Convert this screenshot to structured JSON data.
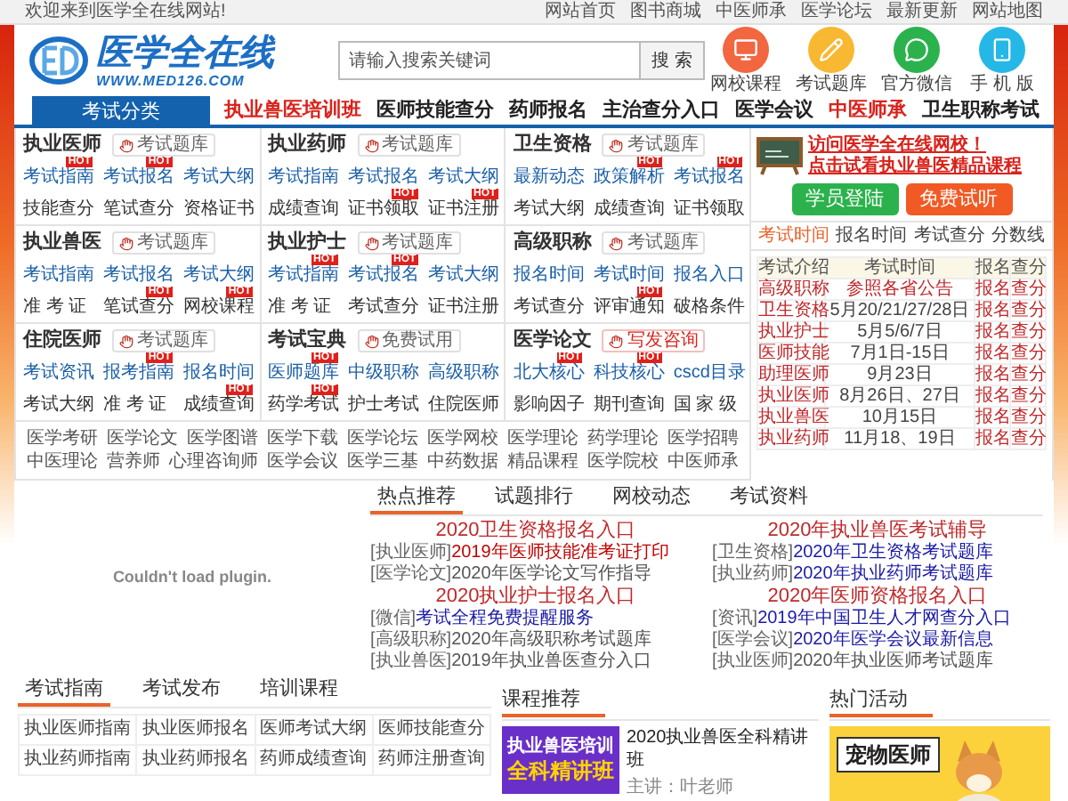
{
  "top_bar": {
    "welcome": "欢迎来到医学全在线网站!",
    "links": [
      "网站首页",
      "图书商城",
      "中医师承",
      "医学论坛",
      "最新更新",
      "网站地图"
    ]
  },
  "header": {
    "logo_text": "医学全在线",
    "logo_url": "WWW.MED126.COM",
    "search": {
      "placeholder": "请输入搜索关键词",
      "button": "搜 索"
    },
    "shortcuts": [
      {
        "label": "网校课程",
        "kind": "monitor",
        "color": "#f26640"
      },
      {
        "label": "考试题库",
        "kind": "pencil",
        "color": "#f8b832"
      },
      {
        "label": "官方微信",
        "kind": "chat",
        "color": "#2bb24c"
      },
      {
        "label": "手 机 版",
        "kind": "phone",
        "color": "#25b8e6"
      }
    ]
  },
  "nav": {
    "category": "考试分类",
    "items": [
      {
        "label": "执业兽医培训班",
        "highlight": true
      },
      {
        "label": "医师技能查分",
        "highlight": false
      },
      {
        "label": "药师报名",
        "highlight": false
      },
      {
        "label": "主治查分入口",
        "highlight": false
      },
      {
        "label": "医学会议",
        "highlight": false
      },
      {
        "label": "中医师承",
        "highlight": true
      },
      {
        "label": "卫生职称考试",
        "highlight": false
      }
    ]
  },
  "categories": [
    {
      "title": "执业医师",
      "button": {
        "label": "考试题库",
        "kind": "normal"
      },
      "rows": [
        {
          "kind": "primary",
          "links": [
            {
              "label": "考试指南",
              "badge": "HOT"
            },
            {
              "label": "考试报名",
              "badge": "HOT"
            },
            {
              "label": "考试大纲"
            }
          ]
        },
        {
          "kind": "secondary",
          "links": [
            {
              "label": "技能查分"
            },
            {
              "label": "笔试查分"
            },
            {
              "label": "资格证书"
            }
          ]
        }
      ]
    },
    {
      "title": "执业药师",
      "button": {
        "label": "考试题库",
        "kind": "normal"
      },
      "rows": [
        {
          "kind": "primary",
          "links": [
            {
              "label": "考试指南"
            },
            {
              "label": "考试报名"
            },
            {
              "label": "考试大纲"
            }
          ]
        },
        {
          "kind": "secondary",
          "links": [
            {
              "label": "成绩查询"
            },
            {
              "label": "证书领取",
              "badge": "HOT"
            },
            {
              "label": "证书注册",
              "badge": "HOT"
            }
          ]
        }
      ]
    },
    {
      "title": "卫生资格",
      "button": {
        "label": "考试题库",
        "kind": "normal"
      },
      "rows": [
        {
          "kind": "primary",
          "links": [
            {
              "label": "最新动态"
            },
            {
              "label": "政策解析",
              "badge": "HOT"
            },
            {
              "label": "考试报名",
              "badge": "HOT"
            }
          ]
        },
        {
          "kind": "secondary",
          "links": [
            {
              "label": "考试大纲"
            },
            {
              "label": "成绩查询"
            },
            {
              "label": "证书领取"
            }
          ]
        }
      ]
    },
    {
      "title": "执业兽医",
      "button": {
        "label": "考试题库",
        "kind": "normal"
      },
      "rows": [
        {
          "kind": "primary",
          "links": [
            {
              "label": "考试指南"
            },
            {
              "label": "考试报名"
            },
            {
              "label": "考试大纲"
            }
          ]
        },
        {
          "kind": "secondary",
          "links": [
            {
              "label": "准 考 证"
            },
            {
              "label": "笔试查分",
              "badge": "HOT"
            },
            {
              "label": "网校课程",
              "badge": "HOT"
            }
          ]
        }
      ]
    },
    {
      "title": "执业护士",
      "button": {
        "label": "考试题库",
        "kind": "normal"
      },
      "rows": [
        {
          "kind": "primary",
          "links": [
            {
              "label": "考试指南",
              "badge": "HOT"
            },
            {
              "label": "考试报名",
              "badge": "HOT"
            },
            {
              "label": "考试大纲"
            }
          ]
        },
        {
          "kind": "secondary",
          "links": [
            {
              "label": "准 考 证"
            },
            {
              "label": "考试查分"
            },
            {
              "label": "证书注册"
            }
          ]
        }
      ]
    },
    {
      "title": "高级职称",
      "button": {
        "label": "考试题库",
        "kind": "normal"
      },
      "rows": [
        {
          "kind": "primary",
          "links": [
            {
              "label": "报名时间"
            },
            {
              "label": "考试时间"
            },
            {
              "label": "报名入口"
            }
          ]
        },
        {
          "kind": "secondary",
          "links": [
            {
              "label": "考试查分"
            },
            {
              "label": "评审通知",
              "badge": "HOT"
            },
            {
              "label": "破格条件"
            }
          ]
        }
      ]
    },
    {
      "title": "住院医师",
      "button": {
        "label": "考试题库",
        "kind": "normal"
      },
      "rows": [
        {
          "kind": "primary",
          "links": [
            {
              "label": "考试资讯"
            },
            {
              "label": "报考指南",
              "badge": "HOT"
            },
            {
              "label": "报名时间"
            }
          ]
        },
        {
          "kind": "secondary",
          "links": [
            {
              "label": "考试大纲"
            },
            {
              "label": "准 考 证"
            },
            {
              "label": "成绩查询",
              "badge": "HOT"
            }
          ]
        }
      ]
    },
    {
      "title": "考试宝典",
      "button": {
        "label": "免费试用",
        "kind": "normal"
      },
      "rows": [
        {
          "kind": "primary",
          "links": [
            {
              "label": "医师题库",
              "badge": "HOT"
            },
            {
              "label": "中级职称"
            },
            {
              "label": "高级职称"
            }
          ]
        },
        {
          "kind": "secondary",
          "links": [
            {
              "label": "药学考试",
              "badge": "HOT"
            },
            {
              "label": "护士考试"
            },
            {
              "label": "住院医师"
            }
          ]
        }
      ]
    },
    {
      "title": "医学论文",
      "button": {
        "label": "写发咨询",
        "kind": "accent"
      },
      "rows": [
        {
          "kind": "primary",
          "links": [
            {
              "label": "北大核心",
              "badge": "HOT"
            },
            {
              "label": "科技核心",
              "badge": "HOT"
            },
            {
              "label": "cscd目录"
            }
          ]
        },
        {
          "kind": "secondary",
          "links": [
            {
              "label": "影响因子"
            },
            {
              "label": "期刊查询"
            },
            {
              "label": "国 家 级"
            }
          ]
        }
      ]
    }
  ],
  "quick_links": [
    [
      "医学考研",
      "医学论文",
      "医学图谱",
      "医学下载",
      "医学论坛",
      "医学网校",
      "医学理论",
      "药学理论",
      "医学招聘"
    ],
    [
      "中医理论",
      "营养师",
      "心理咨询师",
      "医学会议",
      "医学三基",
      "中药数据",
      "精品课程",
      "医学院校",
      "中医师承"
    ]
  ],
  "side_panel": {
    "promo_links": [
      "访问医学全在线网校！",
      "点击试看执业兽医精品课程"
    ],
    "buttons": [
      {
        "label": "学员登陆",
        "kind": "login"
      },
      {
        "label": "免费试听",
        "kind": "trial"
      }
    ],
    "tabs": [
      {
        "label": "考试时间",
        "selected": true
      },
      {
        "label": "报名时间",
        "selected": false
      },
      {
        "label": "考试查分",
        "selected": false
      },
      {
        "label": "分数线",
        "selected": false
      }
    ],
    "table": {
      "columns": [
        "考试介绍",
        "考试时间",
        "报名",
        "查分"
      ],
      "rows": [
        {
          "name": "高级职称",
          "time": "参照各省公告",
          "highlight": true,
          "signup": "报名",
          "score": "查分"
        },
        {
          "name": "卫生资格",
          "time": "5月20/21/27/28日",
          "highlight": false,
          "signup": "报名",
          "score": "查分"
        },
        {
          "name": "执业护士",
          "time": "5月5/6/7日",
          "highlight": false,
          "signup": "报名",
          "score": "查分"
        },
        {
          "name": "医师技能",
          "time": "7月1日-15日",
          "highlight": false,
          "signup": "报名",
          "score": "查分"
        },
        {
          "name": "助理医师",
          "time": "9月23日",
          "highlight": false,
          "signup": "报名",
          "score": "查分"
        },
        {
          "name": "执业医师",
          "time": "8月26日、27日",
          "highlight": false,
          "signup": "报名",
          "score": "查分"
        },
        {
          "name": "执业兽医",
          "time": "10月15日",
          "highlight": false,
          "signup": "报名",
          "score": "查分"
        },
        {
          "name": "执业药师",
          "time": "11月18、19日",
          "highlight": false,
          "signup": "报名",
          "score": "查分"
        }
      ]
    }
  },
  "plugin": {
    "message": "Couldn't load plugin."
  },
  "news": {
    "tabs": [
      {
        "label": "热点推荐",
        "selected": true
      },
      {
        "label": "试题排行",
        "selected": false
      },
      {
        "label": "网校动态",
        "selected": false
      },
      {
        "label": "考试资料",
        "selected": false
      }
    ],
    "columns": [
      [
        {
          "kind": "heading",
          "text": "2020卫生资格报名入口"
        },
        {
          "kind": "item",
          "tag": "[执业医师]",
          "text": "2019年医师技能准考证打印",
          "color": "#c00000"
        },
        {
          "kind": "item",
          "tag": "[医学论文]",
          "text": "2020年医学论文写作指导",
          "color": "#555555"
        },
        {
          "kind": "heading",
          "text": "2020执业护士报名入口"
        },
        {
          "kind": "item",
          "tag": "[微信]",
          "text": "考试全程免费提醒服务",
          "color": "#1a1aa6"
        },
        {
          "kind": "item",
          "tag": "[高级职称]",
          "text": "2020年高级职称考试题库",
          "color": "#555555"
        },
        {
          "kind": "item",
          "tag": "[执业兽医]",
          "text": "2019年执业兽医查分入口",
          "color": "#555555"
        }
      ],
      [
        {
          "kind": "heading",
          "text": "2020年执业兽医考试辅导"
        },
        {
          "kind": "item",
          "tag": "[卫生资格]",
          "text": "2020年卫生资格考试题库",
          "color": "#1a1aa6"
        },
        {
          "kind": "item",
          "tag": "[执业药师]",
          "text": "2020年执业药师考试题库",
          "color": "#1a1aa6"
        },
        {
          "kind": "heading",
          "text": "2020年医师资格报名入口"
        },
        {
          "kind": "item",
          "tag": "[资讯]",
          "text": "2019年中国卫生人才网查分入口",
          "color": "#1a1aa6"
        },
        {
          "kind": "item",
          "tag": "[医学会议]",
          "text": "2020年医学会议最新信息",
          "color": "#1a1aa6"
        },
        {
          "kind": "item",
          "tag": "[执业医师]",
          "text": "2020年执业医师考试题库",
          "color": "#555555"
        }
      ]
    ]
  },
  "guide": {
    "tabs": [
      {
        "label": "考试指南",
        "selected": true
      },
      {
        "label": "考试发布",
        "selected": false
      },
      {
        "label": "培训课程",
        "selected": false
      }
    ],
    "rows": [
      [
        "执业医师指南",
        "执业医师报名",
        "医师考试大纲",
        "医师技能查分"
      ],
      [
        "执业药师指南",
        "执业药师报名",
        "药师成绩查询",
        "药师注册查询"
      ]
    ]
  },
  "courses": {
    "title": "课程推荐",
    "banner": [
      "执业兽医培训",
      "全科精讲班"
    ],
    "course_title": "2020执业兽医全科精讲班",
    "teacher": "主讲：叶老师"
  },
  "activities": {
    "title": "热门活动",
    "sign": "宠物医师"
  }
}
